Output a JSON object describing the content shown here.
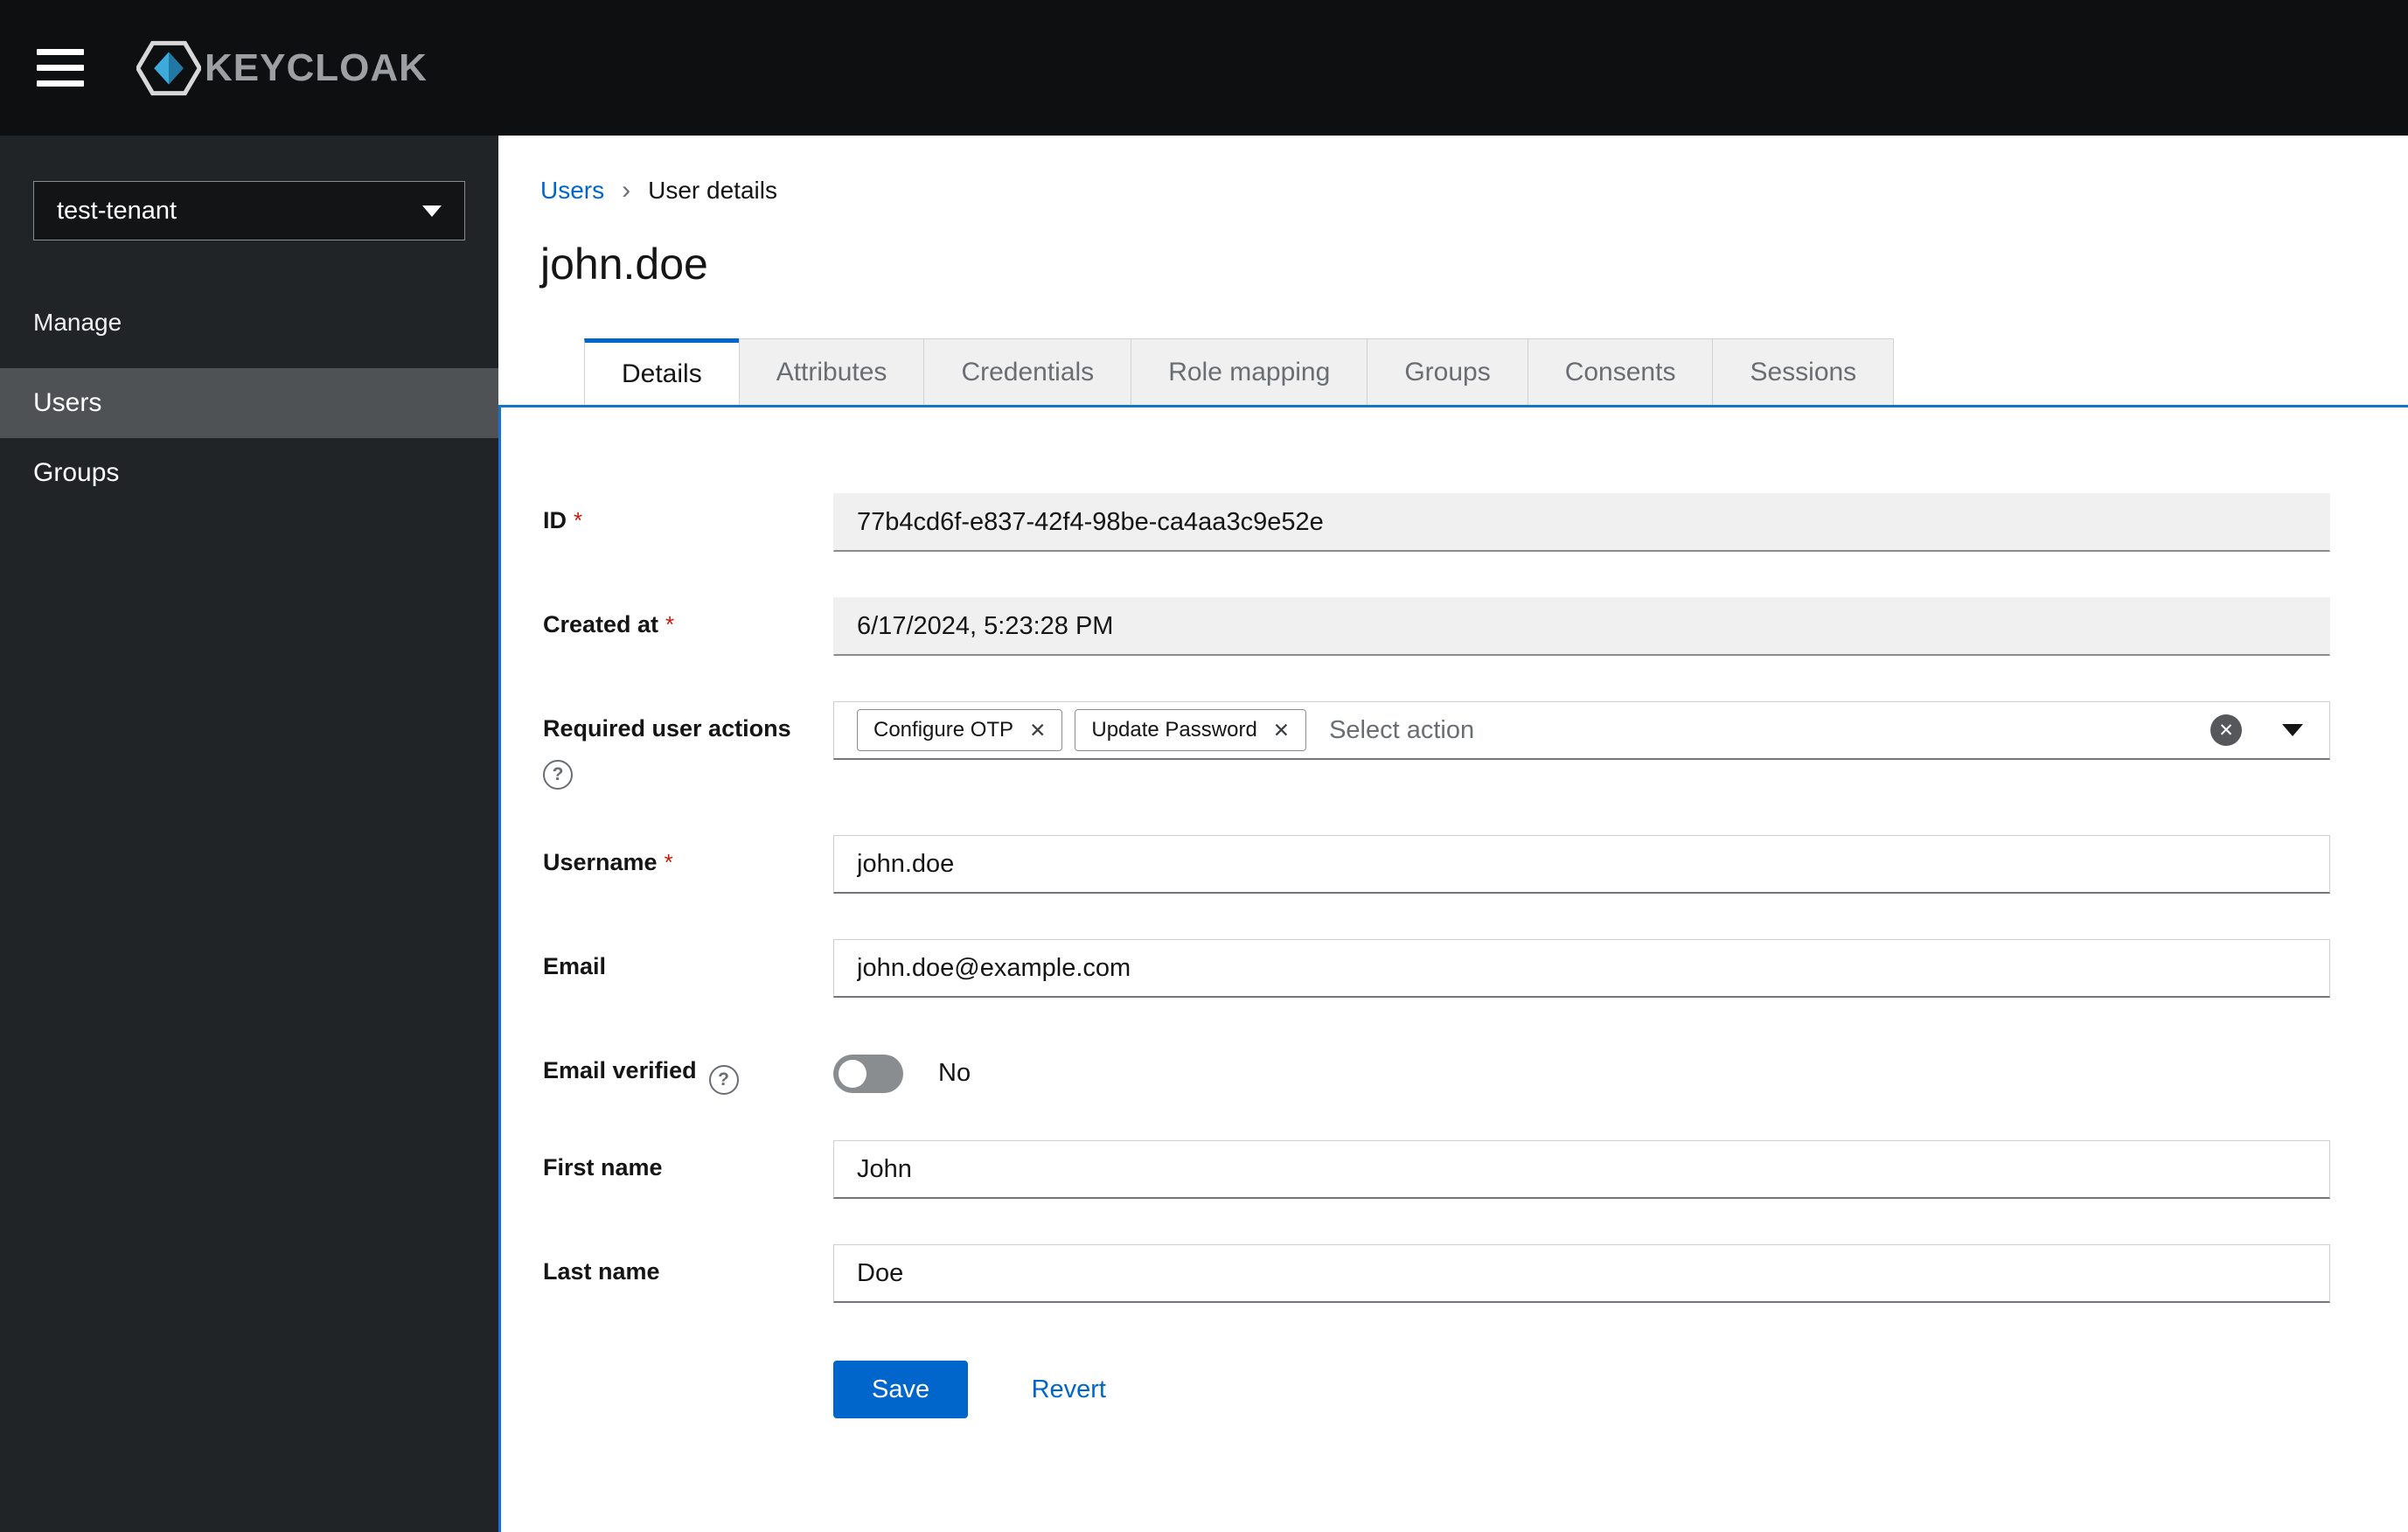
{
  "header": {
    "brand": "KEYCLOAK"
  },
  "sidebar": {
    "realm_selector": {
      "value": "test-tenant"
    },
    "section_label": "Manage",
    "items": [
      {
        "label": "Users"
      },
      {
        "label": "Groups"
      }
    ]
  },
  "breadcrumb": {
    "link": "Users",
    "separator": "›",
    "current": "User details"
  },
  "page_title": "john.doe",
  "tabs": [
    {
      "label": "Details"
    },
    {
      "label": "Attributes"
    },
    {
      "label": "Credentials"
    },
    {
      "label": "Role mapping"
    },
    {
      "label": "Groups"
    },
    {
      "label": "Consents"
    },
    {
      "label": "Sessions"
    }
  ],
  "form": {
    "id": {
      "label": "ID",
      "required": "*",
      "value": "77b4cd6f-e837-42f4-98be-ca4aa3c9e52e"
    },
    "created_at": {
      "label": "Created at",
      "required": "*",
      "value": "6/17/2024, 5:23:28 PM"
    },
    "required_user_actions": {
      "label": "Required user actions",
      "help": "?",
      "chips": [
        {
          "label": "Configure OTP",
          "remove": "✕"
        },
        {
          "label": "Update Password",
          "remove": "✕"
        }
      ],
      "placeholder": "Select action",
      "clear": "✕"
    },
    "username": {
      "label": "Username",
      "required": "*",
      "value": "john.doe"
    },
    "email": {
      "label": "Email",
      "value": "john.doe@example.com"
    },
    "email_verified": {
      "label": "Email verified",
      "help": "?",
      "state": "No"
    },
    "first_name": {
      "label": "First name",
      "value": "John"
    },
    "last_name": {
      "label": "Last name",
      "value": "Doe"
    },
    "actions": {
      "save": "Save",
      "revert": "Revert"
    }
  },
  "colors": {
    "accent_blue": "#0066cc",
    "required_red": "#c9190b",
    "masthead_bg": "#0e0f11",
    "sidebar_bg": "#212427"
  }
}
